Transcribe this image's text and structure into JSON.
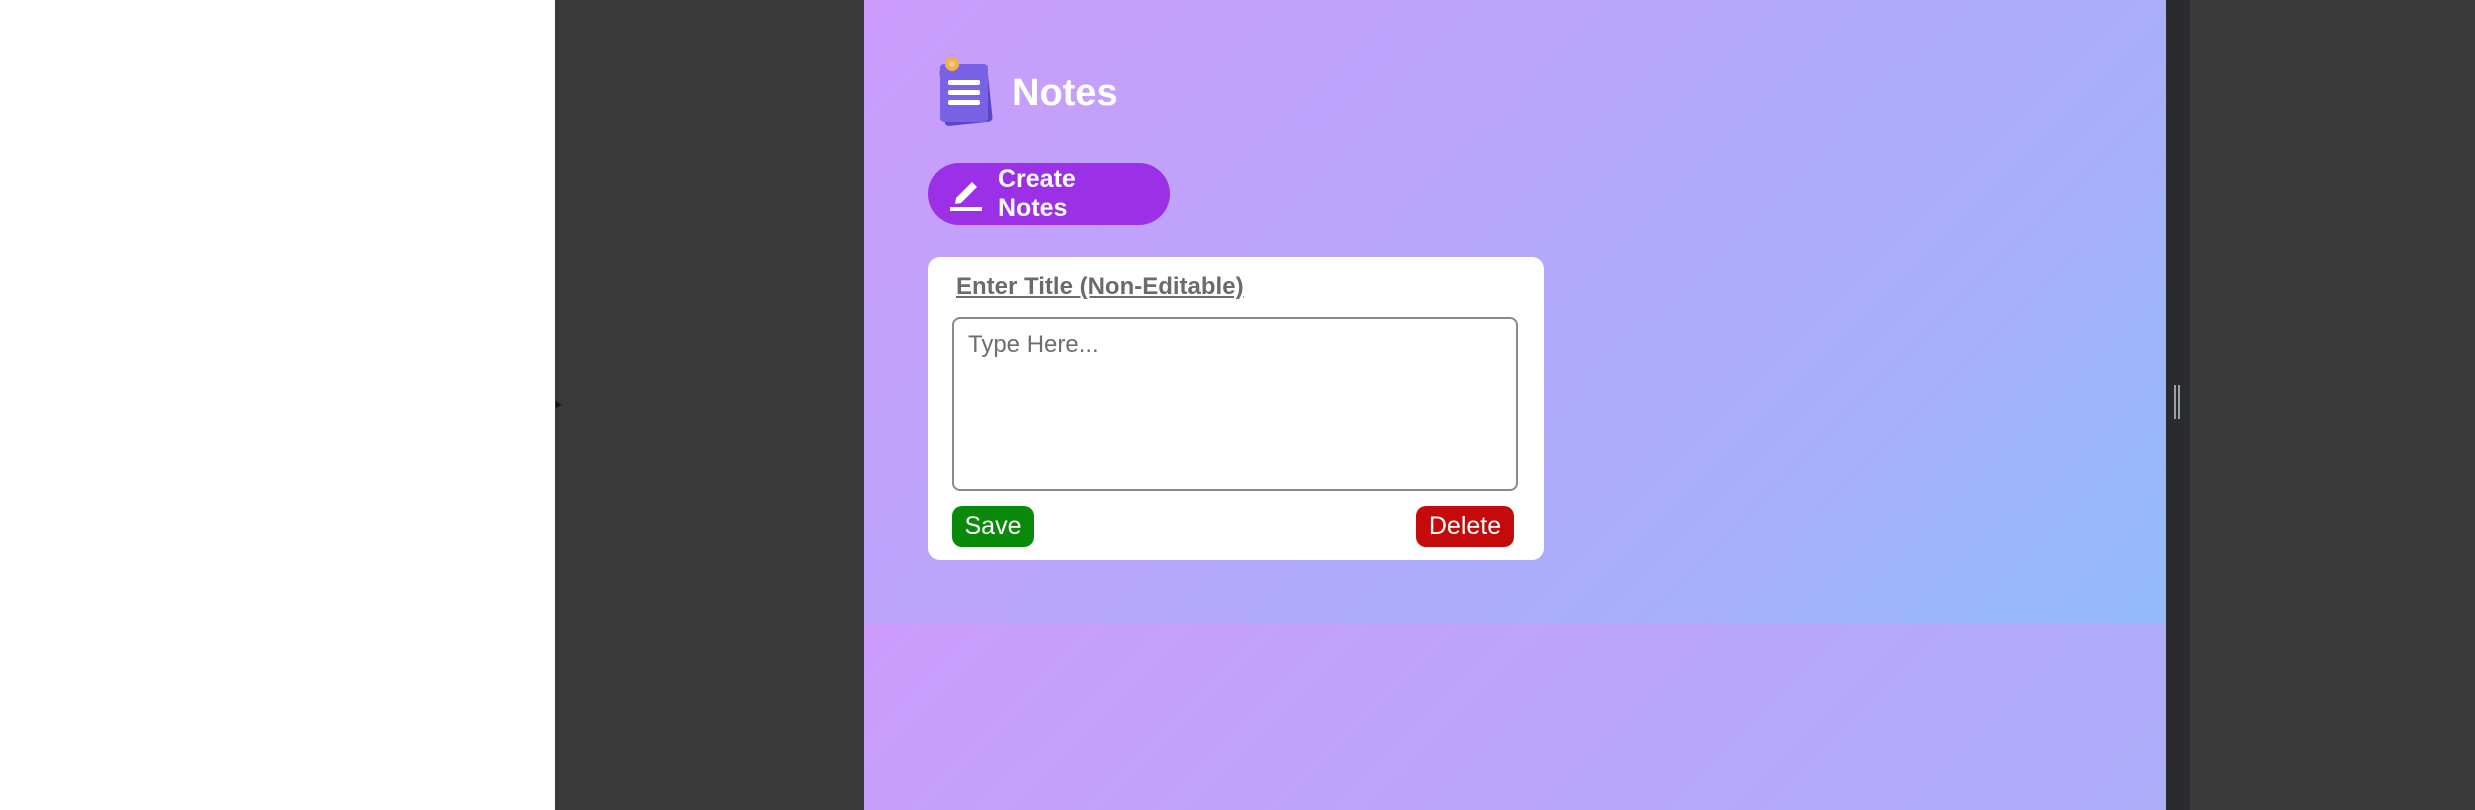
{
  "app": {
    "title": "Notes",
    "logo_icon": "notepad-icon",
    "accent_color": "#9b30e6"
  },
  "toolbar": {
    "create_label": "Create Notes",
    "create_icon": "pencil-icon"
  },
  "note": {
    "title": "Enter Title (Non-Editable)",
    "placeholder": "Type Here...",
    "save_label": "Save",
    "delete_label": "Delete",
    "save_color": "#0a8a0a",
    "delete_color": "#c40a0a"
  }
}
